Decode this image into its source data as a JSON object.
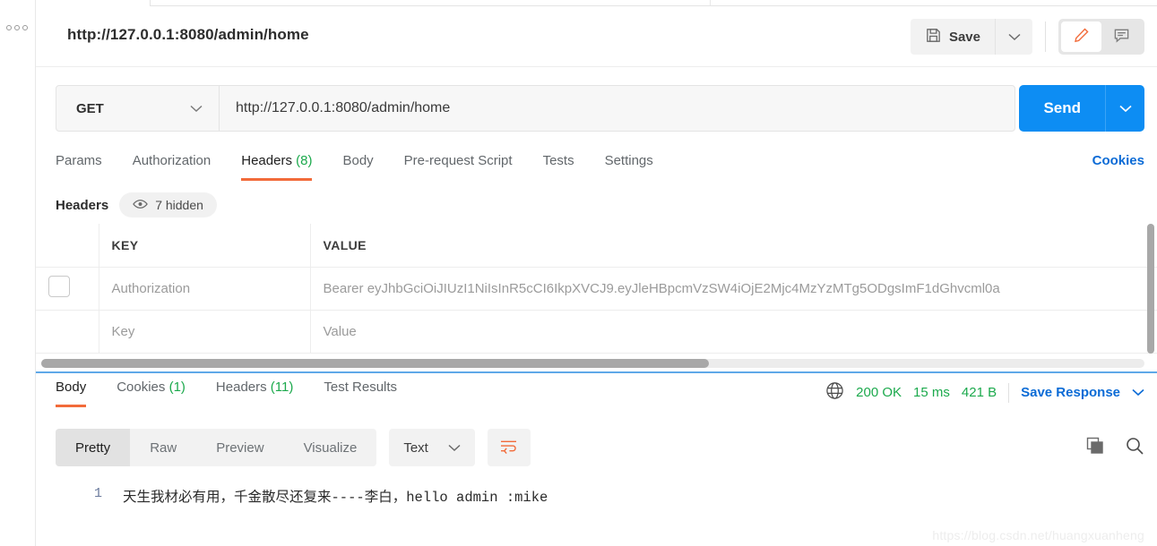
{
  "request": {
    "title": "http://127.0.0.1:8080/admin/home",
    "method": "GET",
    "url": "http://127.0.0.1:8080/admin/home",
    "send_label": "Send",
    "save_label": "Save"
  },
  "request_tabs": [
    {
      "label": "Params",
      "count": "",
      "active": false
    },
    {
      "label": "Authorization",
      "count": "",
      "active": false
    },
    {
      "label": "Headers",
      "count": "(8)",
      "active": true
    },
    {
      "label": "Body",
      "count": "",
      "active": false
    },
    {
      "label": "Pre-request Script",
      "count": "",
      "active": false
    },
    {
      "label": "Tests",
      "count": "",
      "active": false
    },
    {
      "label": "Settings",
      "count": "",
      "active": false
    }
  ],
  "cookies_link": "Cookies",
  "headers_section": {
    "label": "Headers",
    "hidden_pill": "7 hidden",
    "columns": [
      "KEY",
      "VALUE"
    ],
    "rows": [
      {
        "checked": false,
        "key": "Authorization",
        "value": "Bearer eyJhbGciOiJIUzI1NiIsInR5cCI6IkpXVCJ9.eyJleHBpcmVzSW4iOjE2Mjc4MzYzMTg5ODgsImF1dGhvcml0a"
      },
      {
        "checked": false,
        "key": "Key",
        "value": "Value"
      }
    ]
  },
  "response_tabs": [
    {
      "label": "Body",
      "count": "",
      "active": true
    },
    {
      "label": "Cookies",
      "count": "(1)",
      "active": false
    },
    {
      "label": "Headers",
      "count": "(11)",
      "active": false
    },
    {
      "label": "Test Results",
      "count": "",
      "active": false
    }
  ],
  "response_status": {
    "status": "200 OK",
    "time": "15 ms",
    "size": "421 B",
    "save_response": "Save Response"
  },
  "viewer": {
    "modes": [
      {
        "label": "Pretty",
        "active": true
      },
      {
        "label": "Raw",
        "active": false
      },
      {
        "label": "Preview",
        "active": false
      },
      {
        "label": "Visualize",
        "active": false
      }
    ],
    "type": "Text"
  },
  "response_body": {
    "line_number": "1",
    "text": "天生我材必有用，千金散尽还复来----李白，hello admin :mike"
  },
  "watermark": "https://blog.csdn.net/huangxuanheng",
  "colors": {
    "accent_orange": "#f26b3a",
    "send_blue": "#0d8df3",
    "link_blue": "#0b6bd6",
    "success_green": "#1ba94c"
  }
}
